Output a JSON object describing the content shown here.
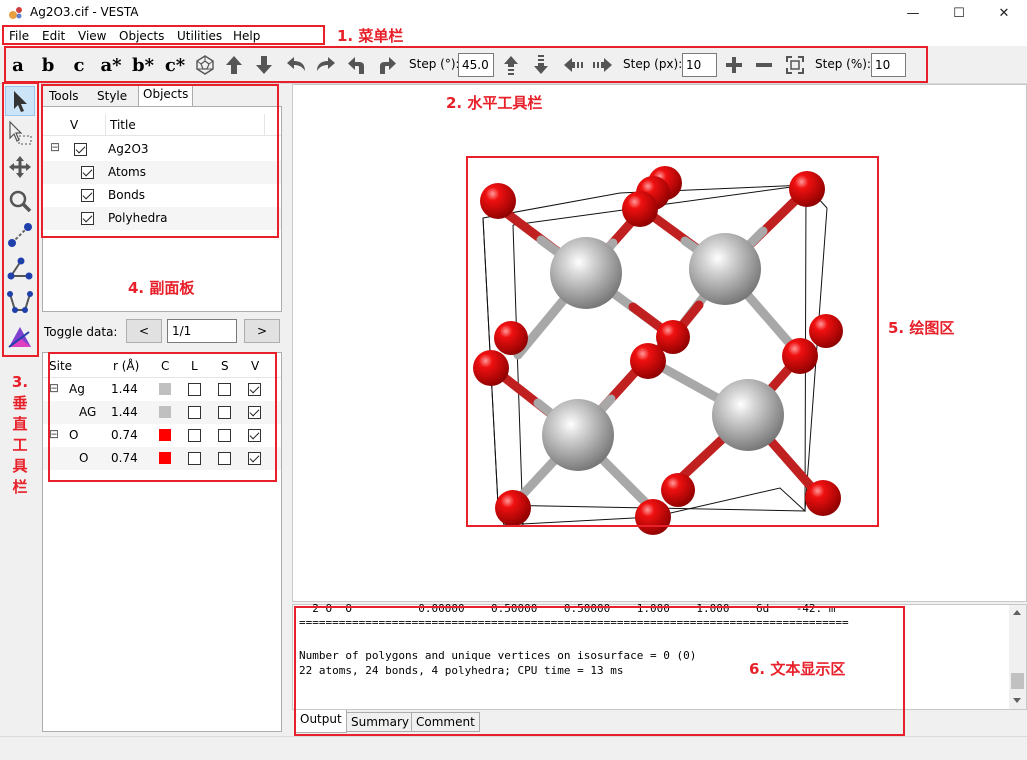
{
  "window": {
    "title": "Ag2O3.cif - VESTA",
    "minimize_glyph": "—",
    "maximize_glyph": "☐",
    "close_glyph": "✕"
  },
  "menu": [
    "File",
    "Edit",
    "View",
    "Objects",
    "Utilities",
    "Help"
  ],
  "toolbar": {
    "axis_buttons": [
      "a",
      "b",
      "c",
      "a*",
      "b*",
      "c*"
    ],
    "step_deg_label": "Step (°):",
    "step_deg_value": "45.0",
    "step_px_label": "Step (px):",
    "step_px_value": "10",
    "step_pct_label": "Step (%):",
    "step_pct_value": "10"
  },
  "side_panel": {
    "tabs": [
      "Tools",
      "Style",
      "Objects"
    ],
    "active_tab": "Objects",
    "objects_header": {
      "v": "V",
      "title": "Title"
    },
    "objects": [
      {
        "expander": "⊟",
        "label": "Ag2O3"
      },
      {
        "label": "Atoms"
      },
      {
        "label": "Bonds"
      },
      {
        "label": "Polyhedra"
      }
    ],
    "toggle_label": "Toggle data:",
    "toggle_prev": "<",
    "toggle_value": "1/1",
    "toggle_next": ">",
    "site_header": [
      "Site",
      "r (Å)",
      "C",
      "L",
      "S",
      "V"
    ],
    "sites": [
      {
        "expander": "⊟",
        "name": "Ag",
        "r": "1.44",
        "color": "#c0c0c0"
      },
      {
        "name": "AG",
        "r": "1.44",
        "color": "#c0c0c0"
      },
      {
        "expander": "⊟",
        "name": "O",
        "r": "0.74",
        "color": "#ff0000"
      },
      {
        "name": "O",
        "r": "0.74",
        "color": "#ff0000"
      }
    ]
  },
  "output": {
    "lines": [
      "  2 O  O          0.00000    0.50000    0.50000    1.000    1.000    6d    -42. m",
      "===================================================================================",
      "",
      "Number of polygons and unique vertices on isosurface = 0 (0)",
      "22 atoms, 24 bonds, 4 polyhedra; CPU time = 13 ms"
    ],
    "tabs": [
      "Output",
      "Summary",
      "Comment"
    ],
    "active_tab": "Output"
  },
  "annotations": {
    "menu_bar": "1. 菜单栏",
    "horizontal_toolbar": "2. 水平工具栏",
    "vertical_toolbar": [
      "3.",
      "垂",
      "直",
      "工",
      "具",
      "栏"
    ],
    "sub_panel": "4. 副面板",
    "drawing_area": "5. 绘图区",
    "text_area": "6. 文本显示区"
  },
  "colors": {
    "annotation": "#e8202a",
    "oxygen": "#ff0000",
    "silver": "#c0c0c0"
  }
}
